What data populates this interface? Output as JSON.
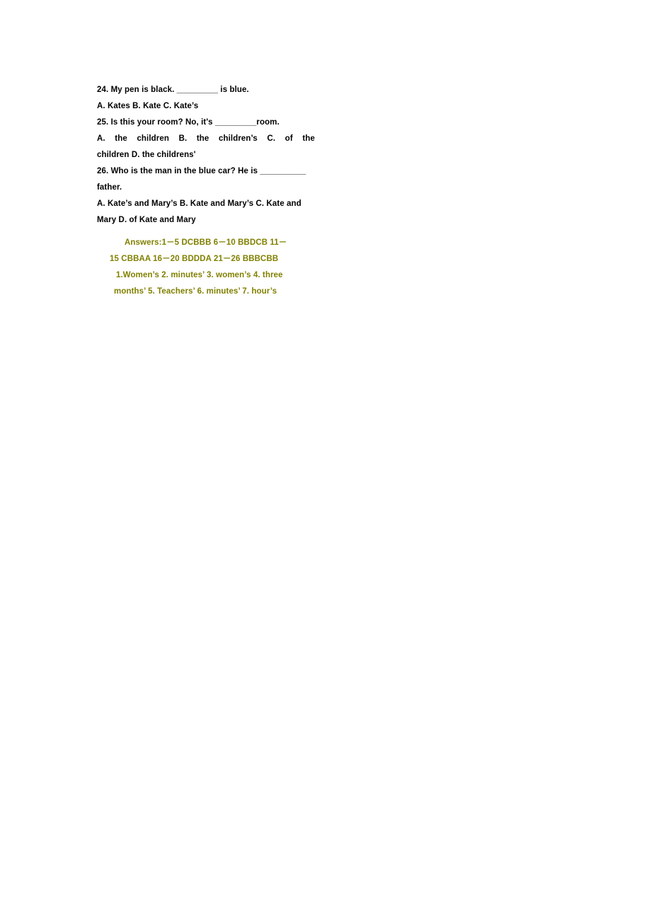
{
  "document": {
    "type": "english-grammar-worksheet-page",
    "background_color": "#ffffff",
    "body_text_color": "#000000",
    "answer_text_color": "#808000"
  },
  "questions": [
    {
      "number": "24.",
      "stem": "24.  My pen is black. _________ is blue.",
      "options_lines": [
        "A. Kates    B. Kate        C. Kate’s"
      ]
    },
    {
      "number": "25.",
      "stem": "25.  Is this your room?  No, it's _________room.",
      "options_lines": [
        "A.  the  children        B.  the  children’s    C.  of  the",
        "children     D. the childrens'"
      ]
    },
    {
      "number": "26.",
      "stem": "26.  Who is the man in the blue car?  He is __________",
      "stem_continuation": "father.",
      "options_lines": [
        "A. Kate’s and Mary’s   B. Kate and Mary’s    C. Kate and",
        "Mary     D. of Kate and Mary"
      ]
    }
  ],
  "answer_key": {
    "label": "Answers:",
    "multiple_choice_lines": [
      "Answers:1－5 DCBBB    6－10 BBDCB     11－",
      "15 CBBAA    16－20 BDDDA    21－26 BBBCBB"
    ],
    "fill_in_lines": [
      "1.Women’s 2. minutes’ 3. women’s  4. three",
      "months’  5. Teachers’  6. minutes’  7. hour’s"
    ]
  }
}
